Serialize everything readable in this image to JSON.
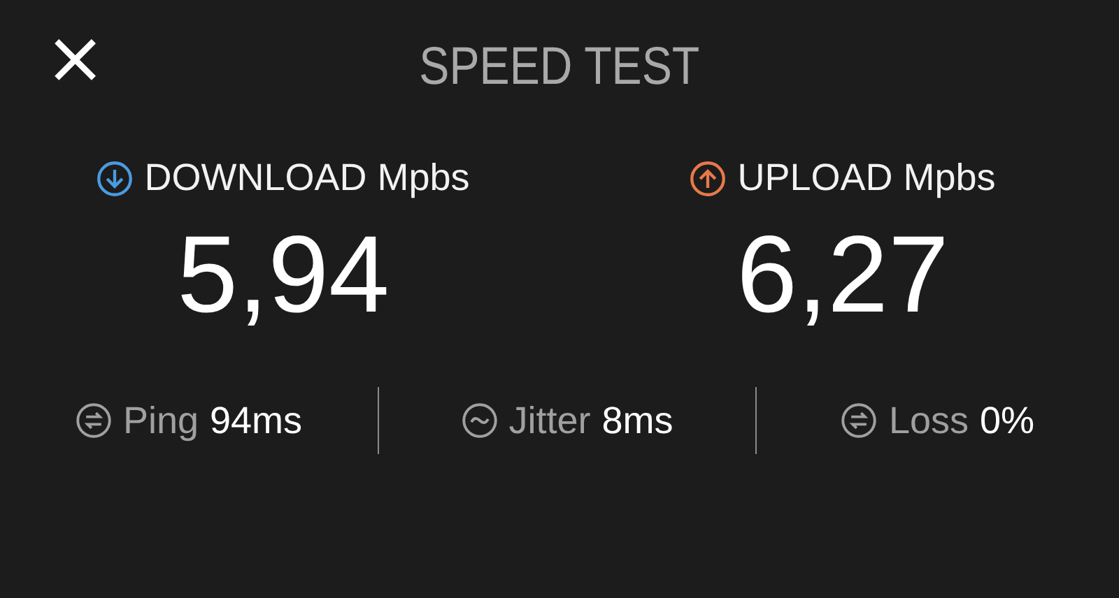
{
  "window": {
    "title": "SPEED TEST",
    "close": "×"
  },
  "results": [
    {
      "kind": "download",
      "label": "DOWNLOAD Mpbs",
      "color": "#4a9be0",
      "value": "5,94"
    },
    {
      "kind": "upload",
      "label": "UPLOAD Mpbs",
      "color": "#e8794a",
      "value": "6,27"
    }
  ],
  "metrics": [
    {
      "kind": "ping",
      "label": "Ping",
      "value": "94ms"
    },
    {
      "kind": "jitter",
      "label": "Jitter",
      "value": "8ms"
    },
    {
      "kind": "loss",
      "label": "Loss",
      "value": "0%"
    }
  ]
}
